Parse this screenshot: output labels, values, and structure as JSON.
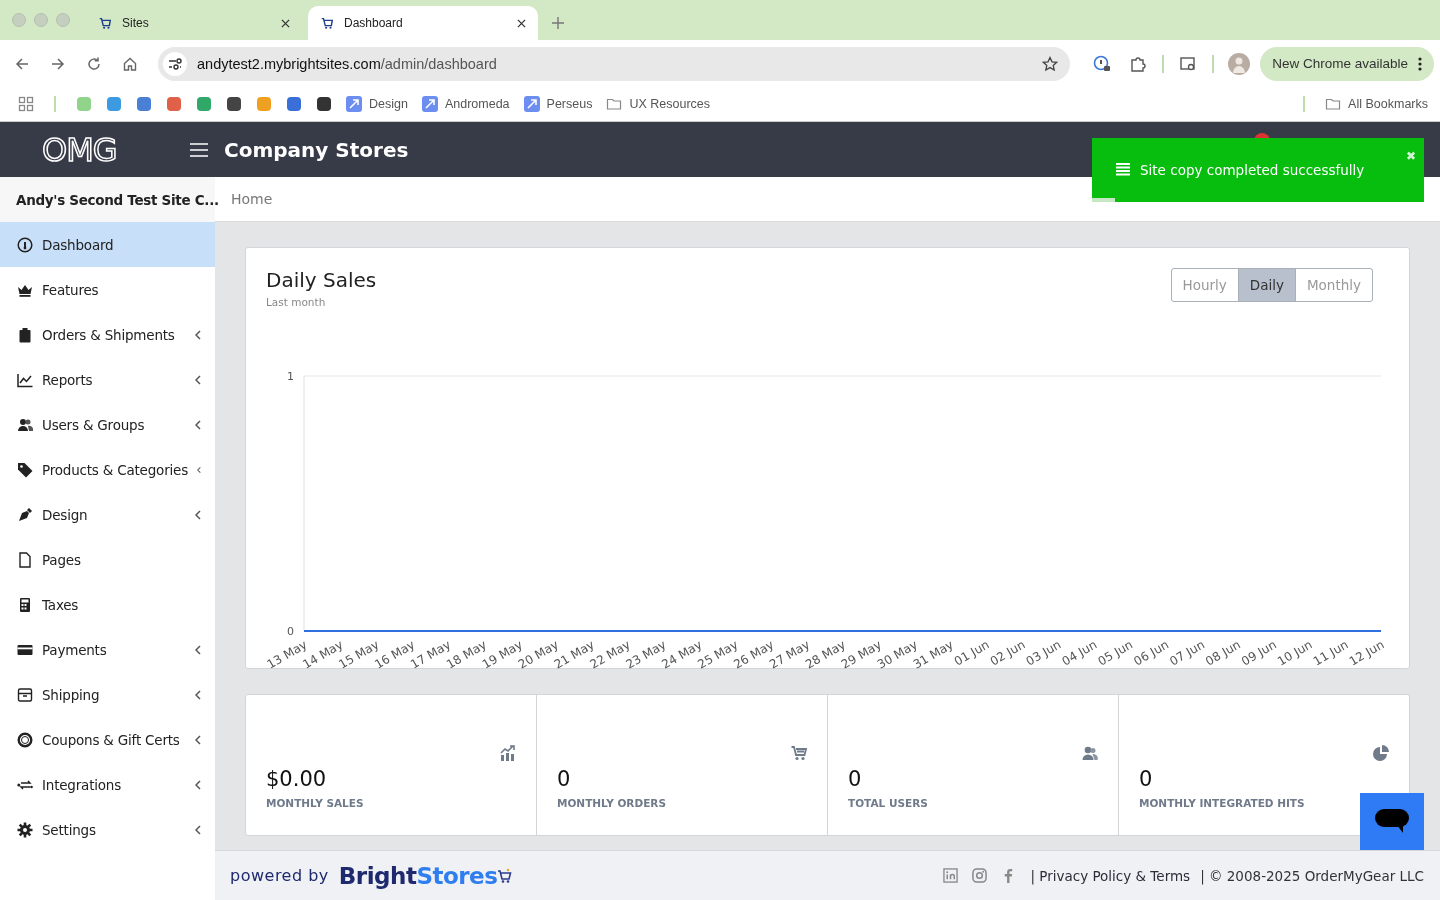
{
  "browser": {
    "tabs": [
      {
        "title": "Sites",
        "selected": false
      },
      {
        "title": "Dashboard",
        "selected": true
      }
    ],
    "address": {
      "host": "andytest2.mybrightsites.com",
      "path": "/admin/dashboard"
    },
    "update_button": "New Chrome available",
    "bookmarks": [
      {
        "label": "Design",
        "kind": "app"
      },
      {
        "label": "Andromeda",
        "kind": "app"
      },
      {
        "label": "Perseus",
        "kind": "app"
      },
      {
        "label": "UX Resources",
        "kind": "folder"
      }
    ],
    "all_bookmarks": "All Bookmarks"
  },
  "header": {
    "logo": "OMG",
    "title": "Company Stores"
  },
  "toast": {
    "message": "Site copy completed successfully",
    "close": "✖",
    "level": 0.07
  },
  "sidebar": {
    "site_name": "Andy's Second Test Site C...",
    "items": [
      {
        "label": "Dashboard",
        "selected": true,
        "expandable": false
      },
      {
        "label": "Features",
        "selected": false,
        "expandable": false
      },
      {
        "label": "Orders & Shipments",
        "selected": false,
        "expandable": true
      },
      {
        "label": "Reports",
        "selected": false,
        "expandable": true
      },
      {
        "label": "Users & Groups",
        "selected": false,
        "expandable": true
      },
      {
        "label": "Products & Categories",
        "selected": false,
        "expandable": true
      },
      {
        "label": "Design",
        "selected": false,
        "expandable": true
      },
      {
        "label": "Pages",
        "selected": false,
        "expandable": false
      },
      {
        "label": "Taxes",
        "selected": false,
        "expandable": false
      },
      {
        "label": "Payments",
        "selected": false,
        "expandable": true
      },
      {
        "label": "Shipping",
        "selected": false,
        "expandable": true
      },
      {
        "label": "Coupons & Gift Certs",
        "selected": false,
        "expandable": true
      },
      {
        "label": "Integrations",
        "selected": false,
        "expandable": true
      },
      {
        "label": "Settings",
        "selected": false,
        "expandable": true
      }
    ]
  },
  "breadcrumb": "Home",
  "sales_card": {
    "title": "Daily Sales",
    "subtitle": "Last month",
    "periods": [
      {
        "label": "Hourly",
        "selected": false
      },
      {
        "label": "Daily",
        "selected": true
      },
      {
        "label": "Monthly",
        "selected": false
      }
    ],
    "chart_data": {
      "type": "line",
      "categories": [
        "13 May",
        "14 May",
        "15 May",
        "16 May",
        "17 May",
        "18 May",
        "19 May",
        "20 May",
        "21 May",
        "22 May",
        "23 May",
        "24 May",
        "25 May",
        "26 May",
        "27 May",
        "28 May",
        "29 May",
        "30 May",
        "31 May",
        "01 Jun",
        "02 Jun",
        "03 Jun",
        "04 Jun",
        "05 Jun",
        "06 Jun",
        "07 Jun",
        "08 Jun",
        "09 Jun",
        "10 Jun",
        "11 Jun",
        "12 Jun"
      ],
      "series": [
        {
          "color": "#2f6fdf",
          "values": [
            0,
            0,
            0,
            0,
            0,
            0,
            0,
            0,
            0,
            0,
            0,
            0,
            0,
            0,
            0,
            0,
            0,
            0,
            0,
            0,
            0,
            0,
            0,
            0,
            0,
            0,
            0,
            0,
            0,
            0,
            0
          ]
        }
      ],
      "ylim": [
        0,
        1
      ],
      "yticks": [
        0,
        1
      ]
    }
  },
  "stats": [
    {
      "value": "$0.00",
      "label": "MONTHLY SALES"
    },
    {
      "value": "0",
      "label": "MONTHLY ORDERS"
    },
    {
      "value": "0",
      "label": "TOTAL USERS"
    },
    {
      "value": "0",
      "label": "MONTHLY INTEGRATED HITS"
    }
  ],
  "footer": {
    "powered_by": "powered by",
    "brand": {
      "first": "Bright",
      "second": "Stores"
    },
    "links": [
      {
        "text": "| Privacy Policy & Terms",
        "kind": "link"
      },
      {
        "text": "| © 2008-2025 OrderMyGear LLC",
        "kind": "text"
      }
    ]
  }
}
